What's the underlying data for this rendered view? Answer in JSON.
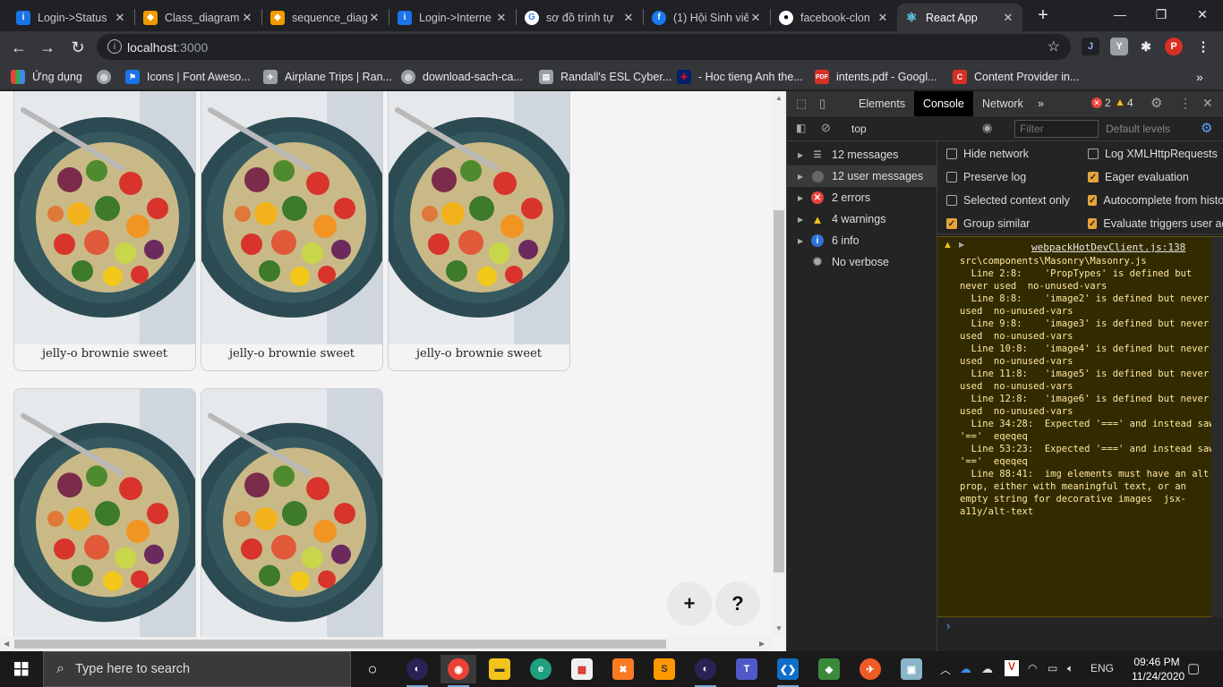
{
  "browser": {
    "tabs": [
      {
        "label": "Login->Status",
        "icon": "info-icon",
        "color": "#1a73e8"
      },
      {
        "label": "Class_diagram",
        "icon": "diagram-icon",
        "color": "#f29900"
      },
      {
        "label": "sequence_diag",
        "icon": "diagram-icon",
        "color": "#f29900"
      },
      {
        "label": "Login->Interne",
        "icon": "info-icon",
        "color": "#1a73e8"
      },
      {
        "label": "sơ đồ trình tự",
        "icon": "google-icon",
        "color": "#ffffff"
      },
      {
        "label": "(1) Hội Sinh viê",
        "icon": "facebook-icon",
        "color": "#1877f2"
      },
      {
        "label": "facebook-clon",
        "icon": "github-icon",
        "color": "#ffffff"
      },
      {
        "label": "React App",
        "icon": "react-icon",
        "color": "#61dafb"
      }
    ],
    "new_tab": "+",
    "url_host": "localhost",
    "url_port": ":3000",
    "profile_initial": "P",
    "extension_letters": [
      "J",
      "Y"
    ]
  },
  "bookmarks": [
    {
      "label": "Ứng dụng",
      "icon": "apps-grid-icon",
      "color": "#e94235"
    },
    {
      "label": "",
      "icon": "globe-icon",
      "color": "#9aa0a6"
    },
    {
      "label": "Icons | Font Aweso...",
      "icon": "flag-icon",
      "color": "#1a73e8"
    },
    {
      "label": "Airplane Trips | Ran...",
      "icon": "plane-icon",
      "color": "#9aa0a6"
    },
    {
      "label": "download-sach-ca...",
      "icon": "globe-icon",
      "color": "#9aa0a6"
    },
    {
      "label": "Randall's ESL Cyber...",
      "icon": "page-icon",
      "color": "#9aa0a6"
    },
    {
      "label": "- Hoc tieng Anh the...",
      "icon": "uk-flag-icon",
      "color": "#c8102e"
    },
    {
      "label": "intents.pdf - Googl...",
      "icon": "pdf-icon",
      "color": "#d93025"
    },
    {
      "label": "Content Provider in...",
      "icon": "c-icon",
      "color": "#d93025"
    }
  ],
  "page": {
    "cards": [
      {
        "caption": "jelly-o brownie sweet"
      },
      {
        "caption": "jelly-o brownie sweet"
      },
      {
        "caption": "jelly-o brownie sweet"
      },
      {
        "caption": ""
      },
      {
        "caption": ""
      }
    ],
    "fab_add": "+",
    "fab_help": "?"
  },
  "devtools": {
    "tabs": [
      "Elements",
      "Console",
      "Network"
    ],
    "active_tab": "Console",
    "more": "»",
    "error_count": "2",
    "warning_count": "4",
    "context": "top",
    "filter_placeholder": "Filter",
    "levels": "Default levels",
    "sidebar": [
      {
        "label": "12 messages",
        "icon": "list-icon"
      },
      {
        "label": "12 user messages",
        "icon": "user-icon"
      },
      {
        "label": "2 errors",
        "icon": "error-icon"
      },
      {
        "label": "4 warnings",
        "icon": "warning-icon"
      },
      {
        "label": "6 info",
        "icon": "info-icon"
      },
      {
        "label": "No verbose",
        "icon": "bug-icon"
      }
    ],
    "settings": [
      {
        "label": "Hide network",
        "checked": false
      },
      {
        "label": "Log XMLHttpRequests",
        "checked": false
      },
      {
        "label": "Preserve log",
        "checked": false
      },
      {
        "label": "Eager evaluation",
        "checked": true
      },
      {
        "label": "Selected context only",
        "checked": false
      },
      {
        "label": "Autocomplete from history",
        "checked": true
      },
      {
        "label": "Group similar",
        "checked": true
      },
      {
        "label": "Evaluate triggers user activation",
        "checked": true
      }
    ],
    "message_source": "webpackHotDevClient.js:138",
    "message_text": "src\\components\\Masonry\\Masonry.js\n  Line 2:8:    'PropTypes' is defined but never used  no-unused-vars\n  Line 8:8:    'image2' is defined but never used  no-unused-vars\n  Line 9:8:    'image3' is defined but never used  no-unused-vars\n  Line 10:8:   'image4' is defined but never used  no-unused-vars\n  Line 11:8:   'image5' is defined but never used  no-unused-vars\n  Line 12:8:   'image6' is defined but never used  no-unused-vars\n  Line 34:28:  Expected '===' and instead saw '=='  eqeqeq\n  Line 53:23:  Expected '===' and instead saw '=='  eqeqeq\n  Line 88:41:  img elements must have an alt prop, either with meaningful text, or an empty string for decorative images  jsx-a11y/alt-text",
    "prompt": "›"
  },
  "taskbar": {
    "search_placeholder": "Type here to search",
    "language": "ENG",
    "time": "09:46 PM",
    "date": "11/24/2020"
  }
}
